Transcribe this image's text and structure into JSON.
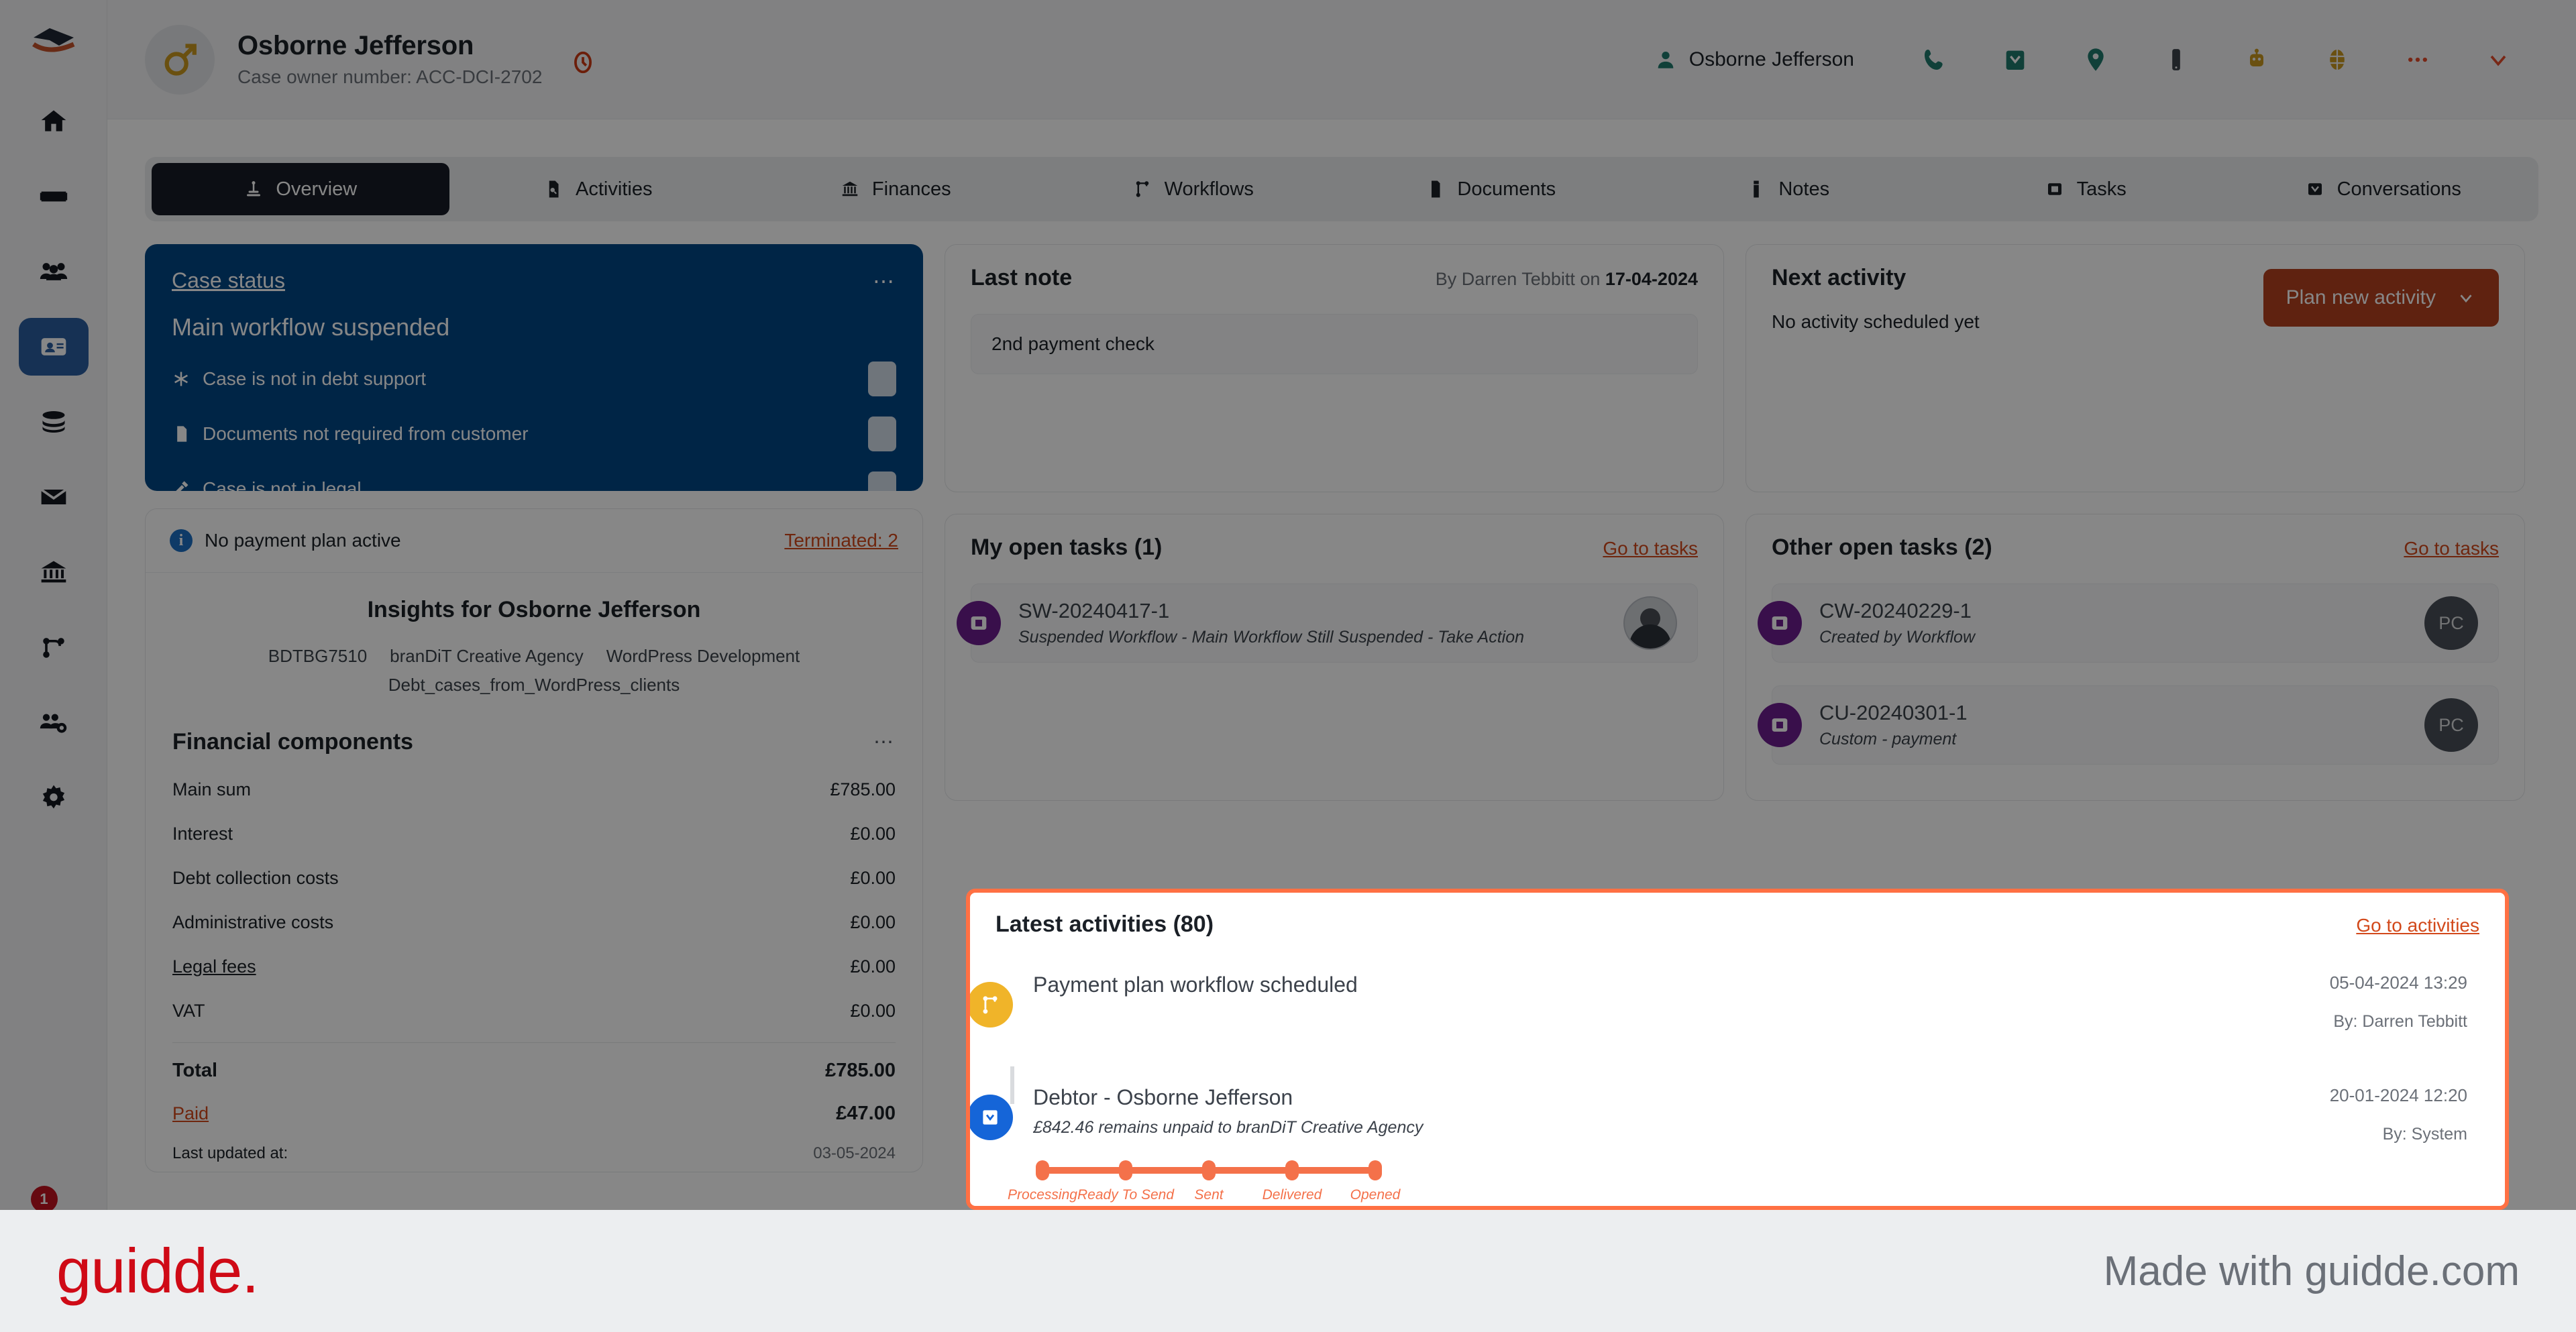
{
  "header": {
    "person_name": "Osborne Jefferson",
    "case_owner_number": "Case owner number: ACC-DCI-2702",
    "avatar_icon": "male-gender-icon",
    "flag_icon": "priority-flag-icon",
    "user_name": "Osborne Jefferson",
    "icons": [
      "phone-icon",
      "email-icon",
      "location-pin-icon",
      "mobile-icon",
      "robot-icon",
      "globe-icon",
      "more-options-icon",
      "chevron-down-icon"
    ]
  },
  "rail": {
    "logo": "app-logo",
    "items": [
      {
        "icon": "home-icon",
        "name": "home",
        "active": false
      },
      {
        "icon": "card-icon",
        "name": "cases",
        "active": false
      },
      {
        "icon": "people-icon",
        "name": "customers",
        "active": false
      },
      {
        "icon": "contact-card-icon",
        "name": "debtors",
        "active": true
      },
      {
        "icon": "database-icon",
        "name": "data",
        "active": false
      },
      {
        "icon": "envelope-icon",
        "name": "mail",
        "active": false
      },
      {
        "icon": "bank-icon",
        "name": "finance",
        "active": false
      },
      {
        "icon": "workflow-icon",
        "name": "workflows",
        "active": false
      },
      {
        "icon": "team-settings-icon",
        "name": "teams",
        "active": false
      },
      {
        "icon": "gear-icon",
        "name": "settings",
        "active": false
      }
    ],
    "badge_count": "1"
  },
  "tabs": [
    {
      "label": "Overview",
      "icon": "overview-icon",
      "active": true
    },
    {
      "label": "Activities",
      "icon": "activities-icon",
      "active": false
    },
    {
      "label": "Finances",
      "icon": "finances-icon",
      "active": false
    },
    {
      "label": "Workflows",
      "icon": "workflows-icon",
      "active": false
    },
    {
      "label": "Documents",
      "icon": "documents-icon",
      "active": false
    },
    {
      "label": "Notes",
      "icon": "notes-icon",
      "active": false
    },
    {
      "label": "Tasks",
      "icon": "tasks-icon",
      "active": false
    },
    {
      "label": "Conversations",
      "icon": "conversations-icon",
      "active": false
    }
  ],
  "case_status": {
    "title": "Case status",
    "subtitle": "Main workflow suspended",
    "menu_icon": "more-options-icon",
    "accent_color": "#004785",
    "rows": [
      {
        "label": "Case is not in debt support",
        "icon": "asterisk-icon"
      },
      {
        "label": "Documents not required from customer",
        "icon": "document-icon"
      },
      {
        "label": "Case is not in legal",
        "icon": "gavel-icon"
      }
    ]
  },
  "payment_plan": {
    "info_icon": "info-icon",
    "text": "No payment plan active",
    "link": "Terminated: 2"
  },
  "insights": {
    "title": "Insights for Osborne Jefferson",
    "tags": [
      "BDTBG7510",
      "branDiT Creative Agency",
      "WordPress Development",
      "Debt_cases_from_WordPress_clients"
    ]
  },
  "financial": {
    "title": "Financial components",
    "menu_icon": "more-options-icon",
    "rows": [
      {
        "label": "Main sum",
        "value": "£785.00",
        "link": false
      },
      {
        "label": "Interest",
        "value": "£0.00",
        "link": false
      },
      {
        "label": "Debt collection costs",
        "value": "£0.00",
        "link": false
      },
      {
        "label": "Administrative costs",
        "value": "£0.00",
        "link": false
      },
      {
        "label": "Legal fees",
        "value": "£0.00",
        "link": true
      },
      {
        "label": "VAT",
        "value": "£0.00",
        "link": false
      }
    ],
    "total_label": "Total",
    "total_value": "£785.00",
    "paid_label": "Paid",
    "paid_value": "£47.00",
    "updated_label": "Last updated at:",
    "updated_value": "03-05-2024"
  },
  "last_note": {
    "title": "Last note",
    "meta_prefix": "By Darren Tebbitt on ",
    "meta_date": "17-04-2024",
    "body": "2nd payment check"
  },
  "next_activity": {
    "title": "Next activity",
    "button_label": "Plan new activity",
    "button_icon": "chevron-down-icon",
    "button_color": "#b3411f",
    "empty_text": "No activity scheduled yet"
  },
  "my_tasks": {
    "title": "My open tasks (1)",
    "link": "Go to tasks",
    "items": [
      {
        "id": "SW-20240417-1",
        "desc": "Suspended Workflow - Main Workflow Still Suspended - Take Action",
        "avatar": "photo",
        "avatar_initials": ""
      }
    ]
  },
  "other_tasks": {
    "title": "Other open tasks (2)",
    "link": "Go to tasks",
    "items": [
      {
        "id": "CW-20240229-1",
        "desc": "Created by Workflow",
        "avatar": "initials",
        "avatar_initials": "PC"
      },
      {
        "id": "CU-20240301-1",
        "desc": "Custom - payment",
        "avatar": "initials",
        "avatar_initials": "PC"
      }
    ]
  },
  "latest_activities": {
    "title": "Latest activities (80)",
    "link": "Go to activities",
    "highlight_color": "#ff7043",
    "items": [
      {
        "icon": "workflow-icon",
        "icon_color": "#f0b429",
        "title": "Payment plan workflow scheduled",
        "subtitle": "",
        "timestamp": "05-04-2024 13:29",
        "by": "By: Darren Tebbitt",
        "track": null
      },
      {
        "icon": "envelope-icon",
        "icon_color": "#1565d8",
        "title": "Debtor - Osborne Jefferson",
        "subtitle": "£842.46 remains unpaid to branDiT Creative Agency",
        "timestamp": "20-01-2024 12:20",
        "by": "By: System",
        "track": {
          "steps": [
            "Processing",
            "Ready To Send",
            "Sent",
            "Delivered",
            "Opened"
          ],
          "color": "#f4714a"
        }
      }
    ]
  },
  "footer": {
    "logo_text": "guidde.",
    "made_with": "Made with guidde.com",
    "logo_color": "#cf0a16"
  }
}
